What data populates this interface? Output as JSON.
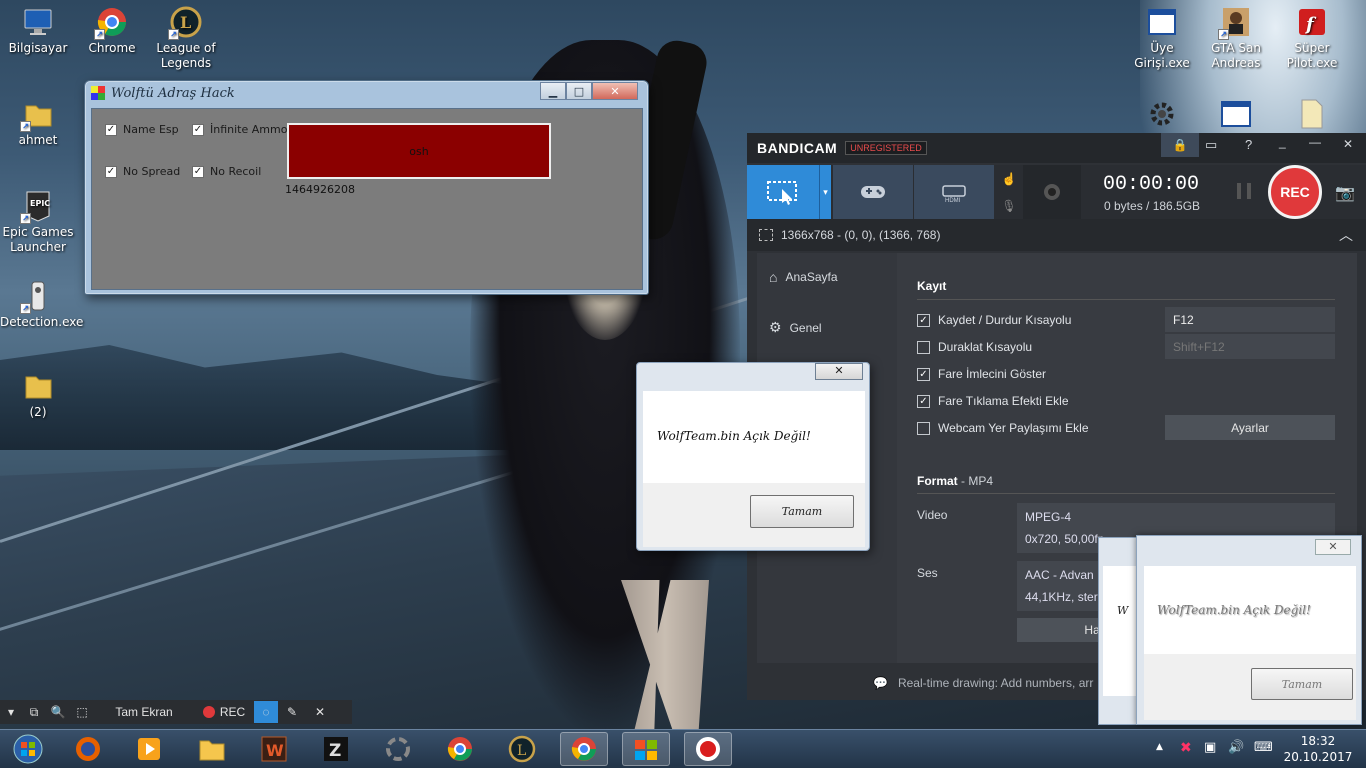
{
  "desktop": {
    "icons_left": [
      {
        "label": "Bilgisayar",
        "icon": "computer-icon"
      },
      {
        "label": "Chrome",
        "icon": "chrome-icon"
      },
      {
        "label": "League of Legends",
        "icon": "league-icon"
      },
      {
        "label": "ahmet",
        "icon": "user-folder-icon"
      },
      {
        "label": "Epic Games Launcher",
        "icon": "epic-games-icon"
      },
      {
        "label": "Detection.exe",
        "icon": "detection-exe-icon"
      },
      {
        "label": "(2)",
        "icon": "folder-icon"
      }
    ],
    "icons_right": [
      {
        "label": "Üye Girişi.exe",
        "icon": "window-app-icon"
      },
      {
        "label": "GTA San Andreas",
        "icon": "gta-icon"
      },
      {
        "label": "Süper Pilot.exe",
        "icon": "flash-icon"
      }
    ]
  },
  "hack_window": {
    "title": "Wolftü Adraş Hack",
    "checkboxes": [
      {
        "label": "Name Esp",
        "checked": true
      },
      {
        "label": "İnfinite Ammo",
        "checked": true
      },
      {
        "label": "No Spread",
        "checked": true
      },
      {
        "label": "No Recoil",
        "checked": true
      }
    ],
    "button_label": "osh",
    "button_color": "#8b0000",
    "value_text": "1464926208"
  },
  "dialog": {
    "message": "WolfTeam.bin Açık Değil!",
    "ok_label": "Tamam"
  },
  "dialog_ghost": {
    "message": "WolfTeam.bin Açık Değil!",
    "ok_label": "Tamam",
    "partial_char": "W"
  },
  "bandicam": {
    "brand": "BANDICAM",
    "badge": "UNREGISTERED",
    "timer": "00:00:00",
    "size": "0 bytes / 186.5GB",
    "rec_label": "REC",
    "region": "1366x768 - (0, 0), (1366, 768)",
    "sidebar": [
      "AnaSayfa",
      "Genel"
    ],
    "section_title": "Kayıt",
    "options": [
      {
        "label": "Kaydet / Durdur Kısayolu",
        "checked": true,
        "value": "F12"
      },
      {
        "label": "Duraklat Kısayolu",
        "checked": false,
        "value": "Shift+F12"
      },
      {
        "label": "Fare İmlecini Göster",
        "checked": true
      },
      {
        "label": "Fare Tıklama Efekti Ekle",
        "checked": true
      },
      {
        "label": "Webcam Yer Paylaşımı Ekle",
        "checked": false
      }
    ],
    "settings_button": "Ayarlar",
    "format_label": "Format",
    "format_value": " - MP4",
    "video_label": "Video",
    "video_codec": "MPEG-4",
    "video_detail": "0x720, 50,00fp",
    "audio_label": "Ses",
    "audio_codec": "AAC - Advan",
    "audio_detail": "44,1KHz, stere",
    "preset_button": "Hazır Ay",
    "footer_tip": "Real-time drawing: Add numbers, arr",
    "accent": "#2f8bd8",
    "rec_color": "#e0393b"
  },
  "recording_toolbar": {
    "mode": "Tam Ekran",
    "rec": "REC"
  },
  "taskbar": {
    "apps": [
      "windows-start-icon",
      "firefox-icon",
      "media-player-icon",
      "file-explorer-icon",
      "game-w-icon",
      "game-z-icon",
      "loading-icon",
      "chrome-icon",
      "league-icon",
      "chrome-icon",
      "windows-app-icon",
      "bandicam-rec-icon"
    ],
    "time": "18:32",
    "date": "20.10.2017"
  }
}
